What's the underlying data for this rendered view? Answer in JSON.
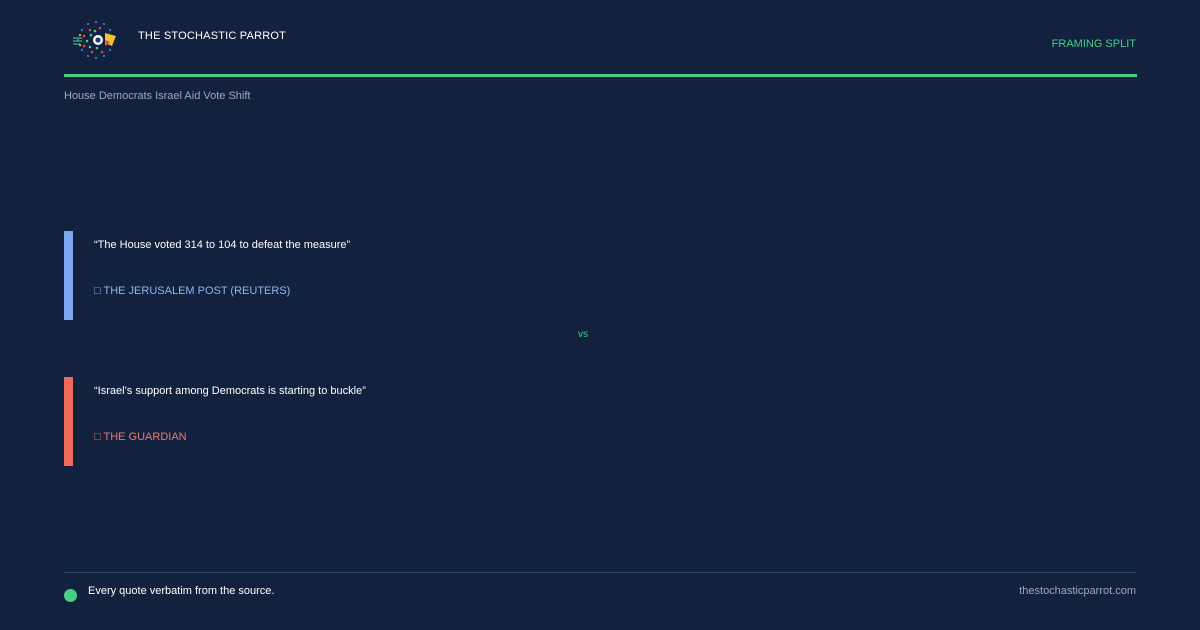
{
  "header": {
    "brand": "THE STOCHASTIC PARROT",
    "label": "FRAMING SPLIT",
    "logo_icon": "parrot-logo-icon"
  },
  "story": {
    "title": "House Democrats Israel Aid Vote Shift"
  },
  "quotes": [
    {
      "text": "“The House voted 314 to 104 to defeat the measure”",
      "source": "□ THE JERUSALEM POST (REUTERS)",
      "color": "#7aa7f0"
    },
    {
      "text": "“Israel’s support among Democrats is starting to buckle”",
      "source": "□ THE GUARDIAN",
      "color": "#ee6b5b"
    }
  ],
  "divider": {
    "vs": "vs"
  },
  "footer": {
    "note": "Every quote verbatim from the source.",
    "site": "thestochasticparrot.com"
  },
  "colors": {
    "background": "#12213d",
    "accent": "#46d086",
    "muted_text": "#9aa8c0"
  }
}
